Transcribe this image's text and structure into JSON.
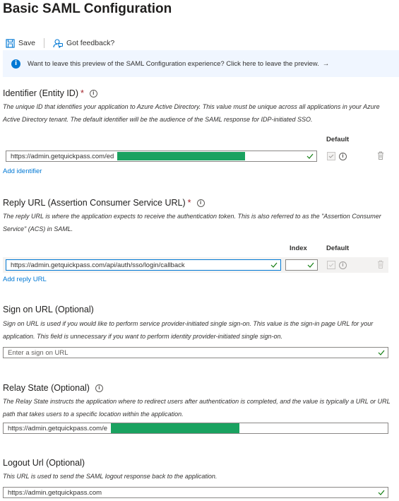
{
  "page": {
    "title": "Basic SAML Configuration"
  },
  "toolbar": {
    "save_label": "Save",
    "feedback_label": "Got feedback?"
  },
  "banner": {
    "text": "Want to leave this preview of the SAML Configuration experience? Click here to leave the preview.",
    "arrow": "→"
  },
  "identifier": {
    "title": "Identifier (Entity ID)",
    "required_mark": "*",
    "description": "The unique ID that identifies your application to Azure Active Directory. This value must be unique across all applications in your Azure Active Directory tenant. The default identifier will be the audience of the SAML response for IDP-initiated SSO.",
    "col_default": "Default",
    "value": "https://admin.getquickpass.com/ed",
    "add_label": "Add identifier"
  },
  "reply": {
    "title": "Reply URL (Assertion Consumer Service URL)",
    "required_mark": "*",
    "description": "The reply URL is where the application expects to receive the authentication token. This is also referred to as the \"Assertion Consumer Service\" (ACS) in SAML.",
    "col_index": "Index",
    "col_default": "Default",
    "value": "https://admin.getquickpass.com/api/auth/sso/login/callback",
    "index_value": "",
    "add_label": "Add reply URL"
  },
  "signon": {
    "title": "Sign on URL (Optional)",
    "description": "Sign on URL is used if you would like to perform service provider-initiated single sign-on. This value is the sign-in page URL for your application. This field is unnecessary if you want to perform identity provider-initiated single sign-on.",
    "placeholder": "Enter a sign on URL"
  },
  "relay": {
    "title": "Relay State (Optional)",
    "description": "The Relay State instructs the application where to redirect users after authentication is completed, and the value is typically a URL or URL path that takes users to a specific location within the application.",
    "value": "https://admin.getquickpass.com/e"
  },
  "logout": {
    "title": "Logout Url (Optional)",
    "description": "This URL is used to send the SAML logout response back to the application.",
    "value": "https://admin.getquickpass.com"
  },
  "colors": {
    "accent": "#0078d4",
    "success": "#107c10",
    "required": "#a4262c",
    "redaction": "#1aa260",
    "banner_bg": "#f0f6ff"
  }
}
